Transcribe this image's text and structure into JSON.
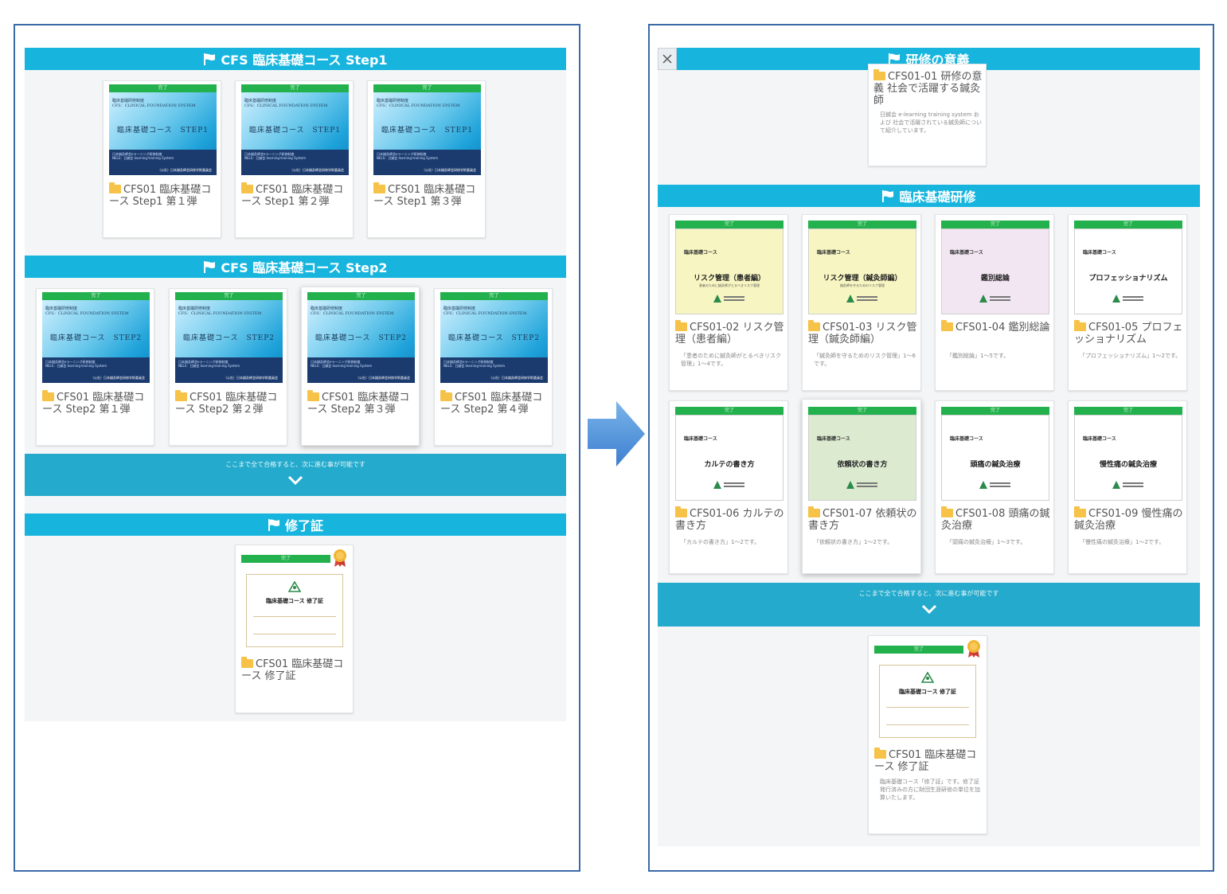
{
  "done_label": "完了",
  "left": {
    "step1": {
      "header": "CFS 臨床基礎コース Step1",
      "cards": [
        {
          "title": "CFS01 臨床基礎コース Step1 第１弾",
          "thumb_title": "臨床基礎コース　STEP1"
        },
        {
          "title": "CFS01 臨床基礎コース Step1 第２弾",
          "thumb_title": "臨床基礎コース　STEP1"
        },
        {
          "title": "CFS01 臨床基礎コース Step1 第３弾",
          "thumb_title": "臨床基礎コース　STEP1"
        }
      ]
    },
    "step2": {
      "header": "CFS 臨床基礎コース Step2",
      "cards": [
        {
          "title": "CFS01 臨床基礎コース Step2 第１弾",
          "thumb_title": "臨床基礎コース　STEP2"
        },
        {
          "title": "CFS01 臨床基礎コース Step2 第２弾",
          "thumb_title": "臨床基礎コース　STEP2"
        },
        {
          "title": "CFS01 臨床基礎コース Step2 第３弾",
          "thumb_title": "臨床基礎コース　STEP2"
        },
        {
          "title": "CFS01 臨床基礎コース Step2 第４弾",
          "thumb_title": "臨床基礎コース　STEP2"
        }
      ]
    },
    "next_text": "ここまで全て合格すると、次に進む事が可能です",
    "completion": {
      "header": "修了証",
      "card": {
        "title": "CFS01 臨床基礎コース 修了証",
        "cert_title": "臨床基礎コース 修了証"
      }
    }
  },
  "thumb_blue": {
    "small_lines": [
      "臨床基礎研修制度",
      "CFS：CLINICAL FOUNDATION SYSTEM"
    ],
    "band_lines": [
      "日本鍼灸師会eラーニング研修制度",
      "NELS：日鍼会 learning-training System"
    ],
    "band_org": "（公社）日本鍼灸師会研修学術委員会"
  },
  "right": {
    "significance": {
      "header": "研修の意義",
      "card": {
        "title": "CFS01-01 研修の意義 社会で活躍する鍼灸師",
        "desc": "日鍼会 e-learning training system および 社会で活躍されている鍼灸師について紹介しています。"
      }
    },
    "training": {
      "header": "臨床基礎研修",
      "doc_head": "臨床基礎コース",
      "cards": [
        {
          "title": "CFS01-02 リスク管理（患者編）",
          "thumb": "リスク管理（患者編）",
          "thumb_sub": "患者のために鍼灸師がとるべきリスク管理",
          "desc": "「患者のために鍼灸師がとるべきリスク管理」1～4です。",
          "bg": "#f7f6c2"
        },
        {
          "title": "CFS01-03 リスク管理（鍼灸師編）",
          "thumb": "リスク管理（鍼灸師編）",
          "thumb_sub": "鍼灸師を守るためのリスク管理",
          "desc": "「鍼灸師を守るためのリスク管理」1～6です。",
          "bg": "#f7f6c2"
        },
        {
          "title": "CFS01-04 鑑別総論",
          "thumb": "鑑別総論",
          "thumb_sub": "",
          "desc": "「鑑別総論」1～5です。",
          "bg": "#f2e6f3"
        },
        {
          "title": "CFS01-05 プロフェッショナリズム",
          "thumb": "プロフェッショナリズム",
          "thumb_sub": "",
          "desc": "「プロフェッショナリズム」1～2です。",
          "bg": "#ffffff"
        },
        {
          "title": "CFS01-06 カルテの書き方",
          "thumb": "カルテの書き方",
          "thumb_sub": "",
          "desc": "「カルテの書き方」1～2です。",
          "bg": "#ffffff"
        },
        {
          "title": "CFS01-07 依頼状の書き方",
          "thumb": "依頼状の書き方",
          "thumb_sub": "",
          "desc": "「依頼状の書き方」1～2です。",
          "bg": "#dcebd0"
        },
        {
          "title": "CFS01-08 頭痛の鍼灸治療",
          "thumb": "頭痛の鍼灸治療",
          "thumb_sub": "",
          "desc": "「頭痛の鍼灸治療」1～3です。",
          "bg": "#ffffff"
        },
        {
          "title": "CFS01-09 慢性痛の鍼灸治療",
          "thumb": "慢性痛の鍼灸治療",
          "thumb_sub": "",
          "desc": "「慢性痛の鍼灸治療」1～2です。",
          "bg": "#ffffff"
        }
      ]
    },
    "next_text": "ここまで全て合格すると、次に進む事が可能です",
    "completion_card": {
      "title": "CFS01 臨床基礎コース 修了証",
      "cert_title": "臨床基礎コース 修了証",
      "desc": "臨床基礎コース「修了証」です。修了証発行済みの方に財団生涯研修の単位を加算いたします。"
    }
  }
}
